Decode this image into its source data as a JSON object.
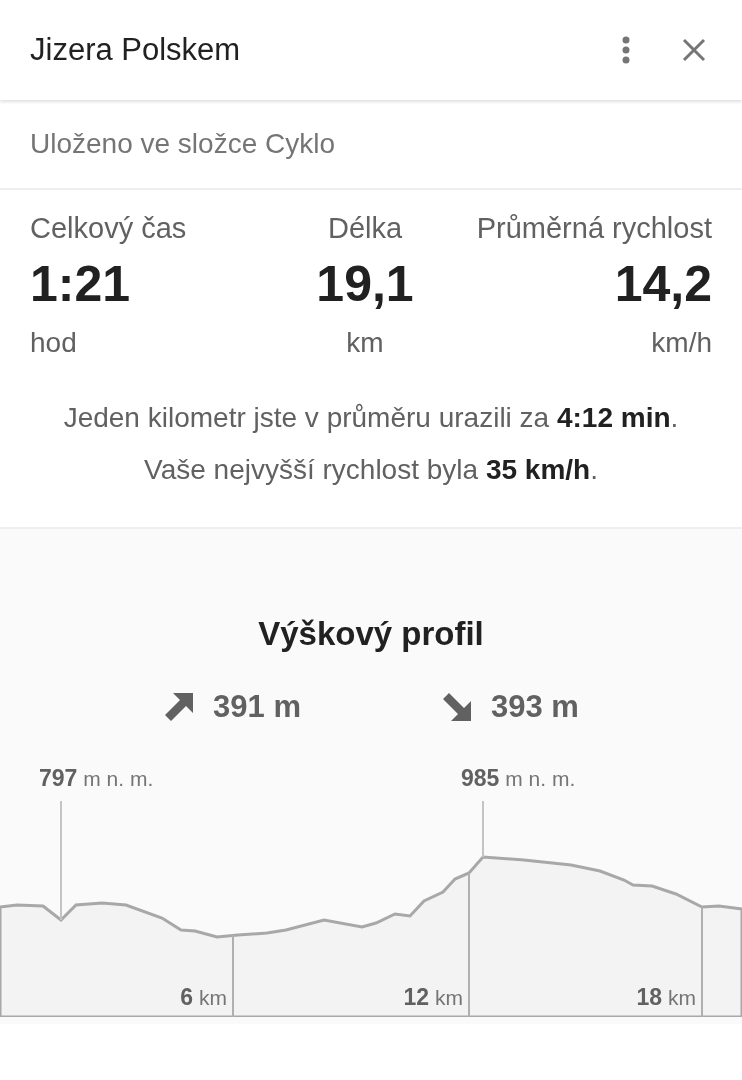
{
  "header": {
    "title": "Jizera Polskem"
  },
  "folder": "Uloženo ve složce Cyklo",
  "stats": [
    {
      "label": "Celkový čas",
      "value": "1:21",
      "unit": "hod"
    },
    {
      "label": "Délka",
      "value": "19,1",
      "unit": "km"
    },
    {
      "label": "Průměrná rychlost",
      "value": "14,2",
      "unit": "km/h"
    }
  ],
  "summary": [
    "Jeden kilometr jste v průměru urazili za **4:12 min**.",
    "Vaše nejvyšší rychlost byla **35 km/h**."
  ],
  "elevation": {
    "title": "Výškový profil",
    "totals": [
      {
        "kind": "ascent",
        "value": "391 m"
      },
      {
        "kind": "descent",
        "value": "393 m"
      }
    ],
    "markers": [
      {
        "kind": "peak",
        "value": "797",
        "unit": "m n. m."
      },
      {
        "kind": "peak",
        "value": "985",
        "unit": "m n. m."
      },
      {
        "kind": "distance",
        "value": "6",
        "unit": "km"
      },
      {
        "kind": "distance",
        "value": "12",
        "unit": "km"
      },
      {
        "kind": "distance",
        "value": "18",
        "unit": "km"
      }
    ]
  }
}
